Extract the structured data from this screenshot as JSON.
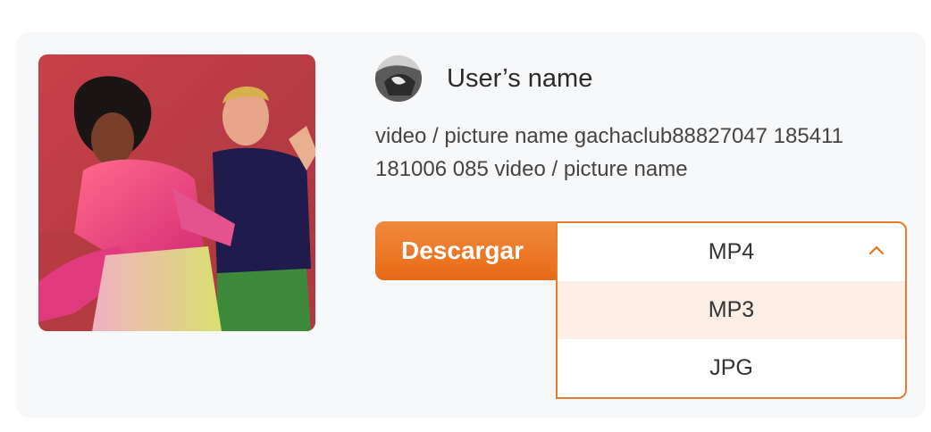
{
  "user": {
    "name": "User’s name"
  },
  "media": {
    "name": "video / picture name gachaclub88827047 185411 181006 085 video / picture name"
  },
  "download": {
    "button_label": "Descargar"
  },
  "format_select": {
    "selected": "MP4",
    "options": [
      "MP3",
      "JPG"
    ],
    "highlighted_option": "MP3"
  },
  "colors": {
    "accent": "#e9741f",
    "dropdown_border": "#ec7a2c",
    "option_hover": "#fbeee4",
    "card_background": "#f7f8fa"
  },
  "icons": {
    "select_toggle": "chevron-up-icon"
  }
}
